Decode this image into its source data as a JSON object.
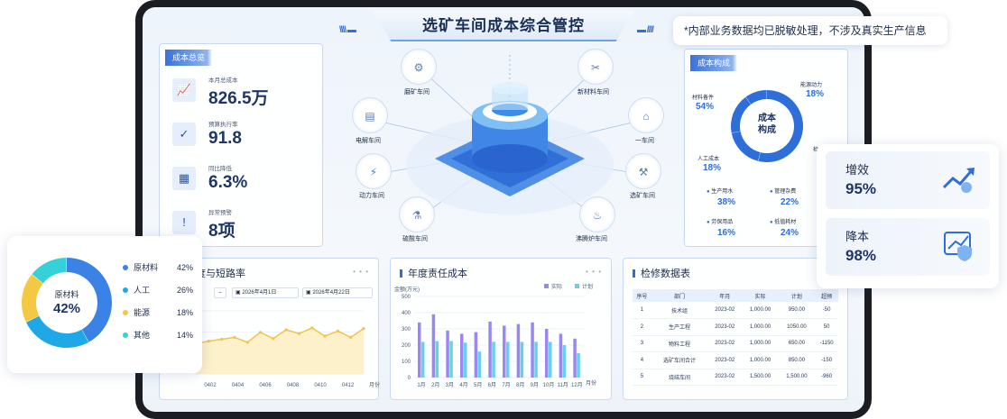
{
  "title": "选矿车间成本综合管控",
  "note": "*内部业务数据均已脱敏处理，不涉及真实生产信息",
  "overview": {
    "title": "成本总览",
    "items": [
      {
        "label": "本月总成本",
        "value": "826.5万"
      },
      {
        "label": "预算执行率",
        "value": "91.8"
      },
      {
        "label": "同比降低",
        "value": "6.3%"
      },
      {
        "label": "异常预警",
        "value": "8项"
      }
    ]
  },
  "nodes": {
    "grinding": "磨矿车间",
    "new_material": "新材料车间",
    "electrolysis": "电解车间",
    "workshop1": "一车间",
    "power": "动力车间",
    "mineral": "选矿车间",
    "sulfuric": "硫酸车间",
    "boiling": "沸腾炉车间"
  },
  "composition": {
    "title": "成本构成",
    "center": "成本构成",
    "labels": [
      {
        "name": "材料备件",
        "value": "54%"
      },
      {
        "name": "能源动力",
        "value": "18%"
      },
      {
        "name": "人工成本",
        "value": "18%"
      },
      {
        "name": "检",
        "value": ""
      }
    ],
    "chart_data": {
      "type": "pie",
      "categories": [
        "材料备件",
        "能源动力",
        "人工成本",
        "检"
      ],
      "values": [
        54,
        18,
        18,
        10
      ]
    },
    "sub": [
      {
        "name": "生产用水",
        "value": "38%"
      },
      {
        "name": "管理杂费",
        "value": "22%"
      },
      {
        "name": "劳保用品",
        "value": "16%"
      },
      {
        "name": "低值耗材",
        "value": "24%"
      }
    ]
  },
  "efficiency": {
    "label": "增效",
    "value": "95%"
  },
  "reduction": {
    "label": "降本",
    "value": "98%"
  },
  "donut_card": {
    "center_label": "原材料",
    "center_value": "42%",
    "chart_data": {
      "type": "pie",
      "categories": [
        "原材料",
        "人工",
        "能源",
        "其他"
      ],
      "values": [
        42,
        26,
        18,
        14
      ],
      "colors": [
        "#3b82e6",
        "#1fa8e8",
        "#f3c843",
        "#36d0d8"
      ]
    },
    "legend": [
      {
        "name": "原材料",
        "value": "42%",
        "color": "#3b82e6"
      },
      {
        "name": "人工",
        "value": "26%",
        "color": "#1fa8e8"
      },
      {
        "name": "能源",
        "value": "18%",
        "color": "#f3c843"
      },
      {
        "name": "其他",
        "value": "14%",
        "color": "#36d0d8"
      }
    ]
  },
  "line_panel": {
    "title": "度与短路率",
    "date_from": "2026年4月1日",
    "date_to": "2026年4月22日",
    "more": "• • •",
    "x_unit": "月份",
    "chart_data": {
      "type": "area",
      "x": [
        "0402",
        "0404",
        "0406",
        "0408",
        "0410",
        "0412"
      ],
      "values": [
        48,
        52,
        55,
        58,
        50,
        66,
        56,
        70,
        64,
        73,
        60,
        68,
        58,
        72
      ]
    }
  },
  "bar_panel": {
    "title": "年度责任成本",
    "unit": "金额(万元)",
    "x_unit": "月份",
    "more": "• • •",
    "chart_data": {
      "type": "bar",
      "categories": [
        "1月",
        "2月",
        "3月",
        "4月",
        "5月",
        "6月",
        "7月",
        "8月",
        "9月",
        "10月",
        "11月",
        "12月"
      ],
      "series": [
        {
          "name": "实际",
          "values": [
            340,
            390,
            290,
            270,
            280,
            345,
            320,
            330,
            340,
            300,
            270,
            240
          ]
        },
        {
          "name": "计划",
          "values": [
            220,
            225,
            225,
            215,
            160,
            220,
            220,
            220,
            220,
            220,
            200,
            150
          ]
        }
      ],
      "ylim": [
        0,
        500
      ],
      "yticks": [
        0,
        100,
        200,
        300,
        400,
        500
      ]
    }
  },
  "table_panel": {
    "title": "检修数据表",
    "more": "• • •",
    "headers": [
      "序号",
      "部门",
      "年月",
      "实际",
      "计划",
      "超预"
    ],
    "rows": [
      [
        "1",
        "技术组",
        "2023-02",
        "1,000.00",
        "950.00",
        "-50"
      ],
      [
        "2",
        "生产工程",
        "2023-02",
        "1,000.00",
        "1050.00",
        "50"
      ],
      [
        "3",
        "物料工程",
        "2023-02",
        "1,000.00",
        "650.00",
        "-1150"
      ],
      [
        "4",
        "选矿车间合计",
        "2023-02",
        "1,000.00",
        "850.00",
        "-150"
      ],
      [
        "5",
        "烧结车间",
        "2023-02",
        "1,500.00",
        "1,500.00",
        "-960"
      ]
    ]
  },
  "colors": {
    "accent": "#2d6ed8",
    "actual": "#9b87f2",
    "plan": "#66d2e8"
  }
}
